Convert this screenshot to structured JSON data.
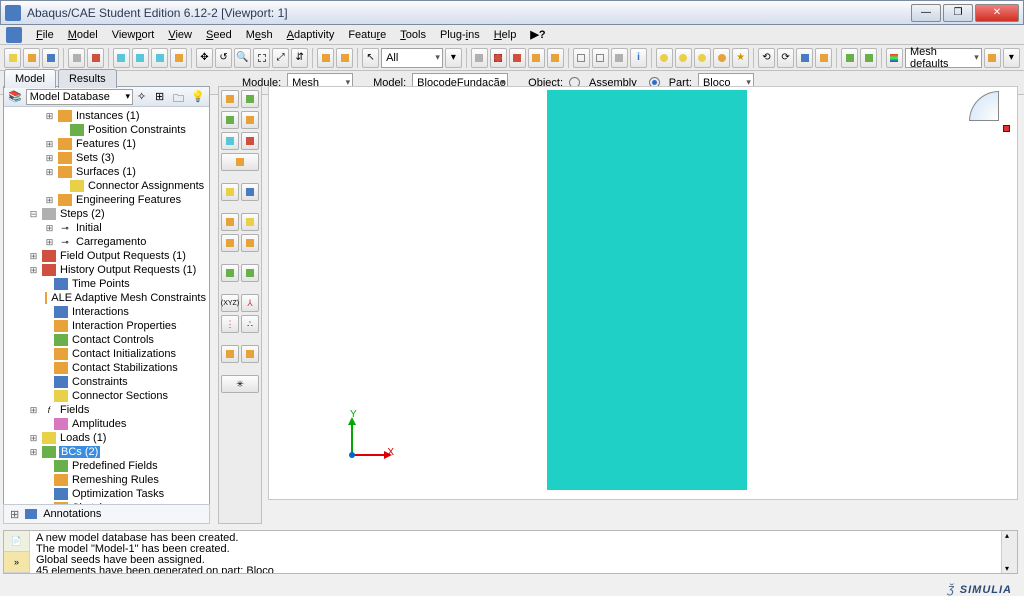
{
  "window": {
    "title": "Abaqus/CAE Student Edition 6.12-2 [Viewport: 1]"
  },
  "menu": {
    "file": "File",
    "model": "Model",
    "viewport": "Viewport",
    "view": "View",
    "seed": "Seed",
    "mesh": "Mesh",
    "adaptivity": "Adaptivity",
    "feature": "Feature",
    "tools": "Tools",
    "plugins": "Plug-ins",
    "help": "Help"
  },
  "toolbar": {
    "filter": "All",
    "renderopt": "Mesh defaults"
  },
  "context": {
    "module_label": "Module:",
    "module": "Mesh",
    "model_label": "Model:",
    "model": "BlocodeFundação",
    "object_label": "Object:",
    "assembly": "Assembly",
    "part_label": "Part:",
    "part": "Bloco"
  },
  "tabs": {
    "model": "Model",
    "results": "Results"
  },
  "treehdr": {
    "label": "Model Database"
  },
  "tree": {
    "instances": "Instances (1)",
    "posc": "Position Constraints",
    "features": "Features (1)",
    "sets": "Sets (3)",
    "surfaces": "Surfaces (1)",
    "connassign": "Connector Assignments",
    "engfeat": "Engineering Features",
    "steps": "Steps (2)",
    "initial": "Initial",
    "carreg": "Carregamento",
    "fieldout": "Field Output Requests (1)",
    "histout": "History Output Requests (1)",
    "timepts": "Time Points",
    "ale": "ALE Adaptive Mesh Constraints",
    "inter": "Interactions",
    "interprop": "Interaction Properties",
    "contactctrl": "Contact Controls",
    "contactinit": "Contact Initializations",
    "contactstab": "Contact Stabilizations",
    "constraints": "Constraints",
    "connsect": "Connector Sections",
    "fields": "Fields",
    "amplitudes": "Amplitudes",
    "loads": "Loads (1)",
    "bcs": "BCs (2)",
    "predef": "Predefined Fields",
    "remesh": "Remeshing Rules",
    "opttask": "Optimization Tasks",
    "sketches": "Sketches",
    "annotations": "Annotations"
  },
  "axes": {
    "x": "X",
    "y": "Y"
  },
  "brand": {
    "label": "SIMULIA"
  },
  "messages": {
    "l1": "A new model database has been created.",
    "l2": "The model \"Model-1\" has been created.",
    "l3": "Global seeds have been assigned.",
    "l4": "45 elements have been generated on part: Bloco"
  }
}
